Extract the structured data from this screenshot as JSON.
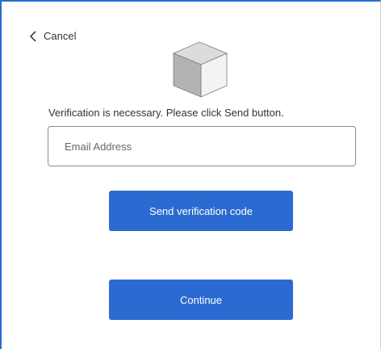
{
  "nav": {
    "cancel_label": "Cancel",
    "cancel_icon": "chevron-left-icon"
  },
  "logo": {
    "icon": "cube-icon"
  },
  "verification": {
    "instruction": "Verification is necessary. Please click Send button.",
    "email_placeholder": "Email Address",
    "email_value": "",
    "send_button_label": "Send verification code"
  },
  "footer": {
    "continue_button_label": "Continue"
  },
  "colors": {
    "accent": "#2b6bd1",
    "text": "#333333",
    "cube_top": "#dcdcdc",
    "cube_left": "#b3b3b3",
    "cube_right": "#f3f3f3"
  }
}
